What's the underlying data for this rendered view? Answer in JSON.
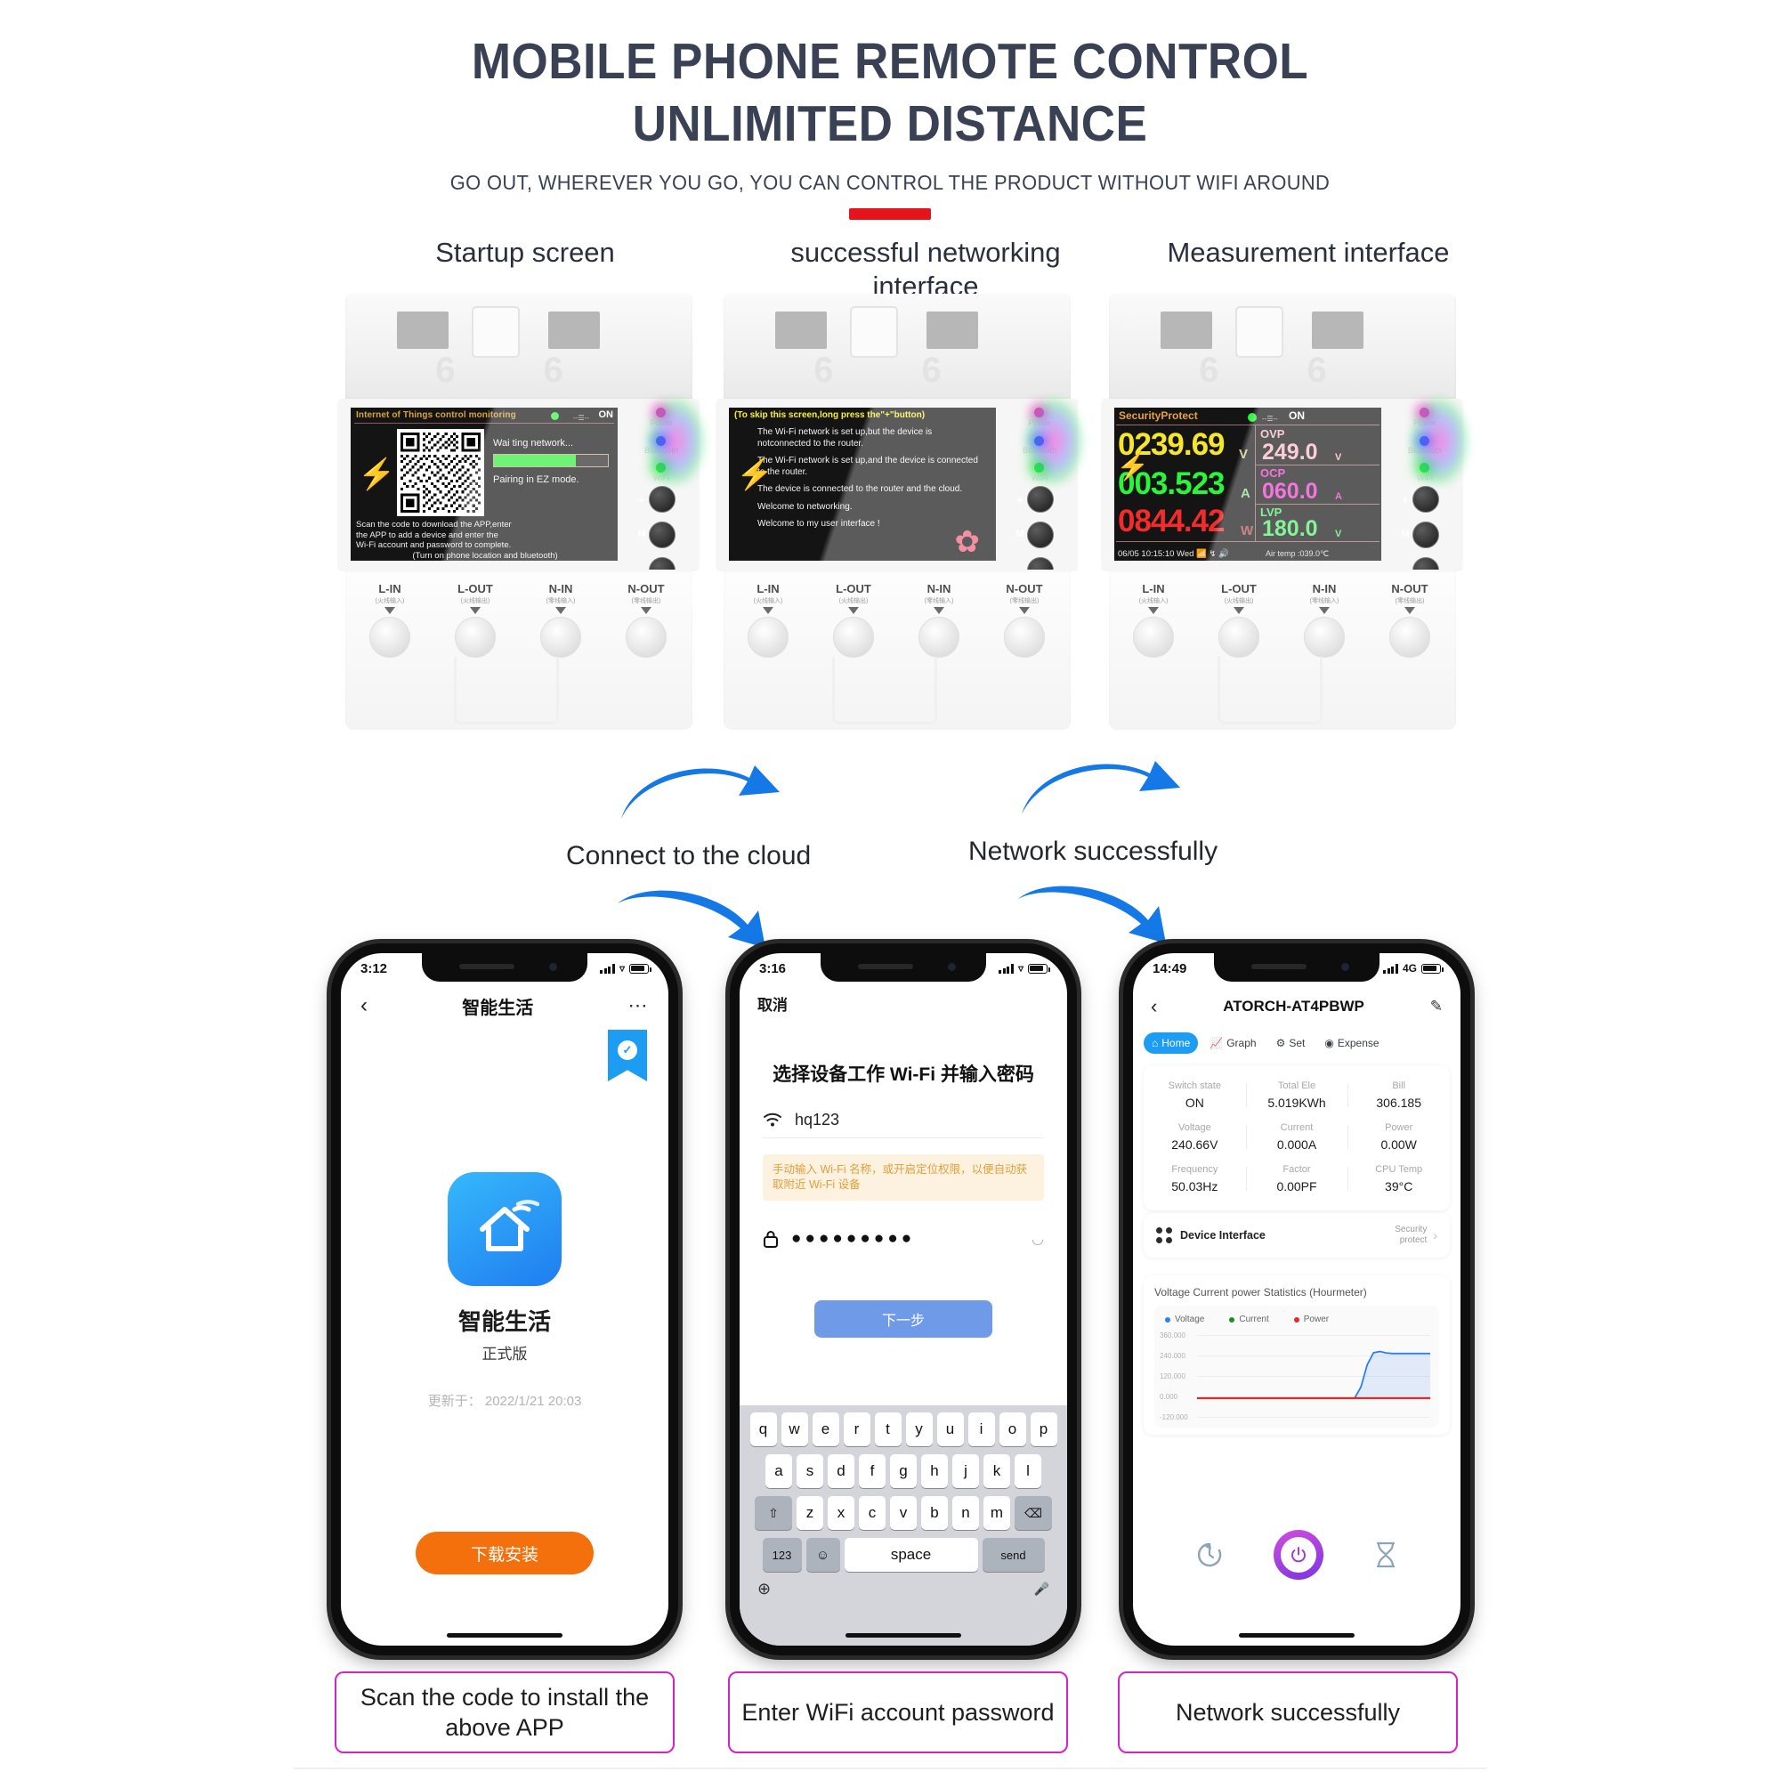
{
  "header": {
    "title_line1": "MOBILE PHONE REMOTE CONTROL",
    "title_line2": "UNLIMITED DISTANCE",
    "subtitle": "GO OUT, WHEREVER YOU GO, YOU CAN CONTROL THE PRODUCT WITHOUT WIFI AROUND"
  },
  "column_titles": [
    "Startup screen",
    "successful networking interface",
    "Measurement interface"
  ],
  "device": {
    "ghost_digits": "6 6",
    "terminals": [
      {
        "name": "L-IN",
        "cn": "(火线输入)"
      },
      {
        "name": "L-OUT",
        "cn": "(火线输出)"
      },
      {
        "name": "N-IN",
        "cn": "(零线输入)"
      },
      {
        "name": "N-OUT",
        "cn": "(零线输出)"
      }
    ],
    "led_labels": [
      "Power",
      "Bluetooth",
      "WiFi"
    ],
    "button_symbols": [
      "+",
      "M",
      "-"
    ]
  },
  "screen1": {
    "title": "Internet of Things control monitoring",
    "status_on": "ON",
    "dash": "--☰--",
    "waiting": "Wai ting network...",
    "pairing": "Pairing in EZ mode.",
    "progress_percent": 72,
    "instructions_l1": "Scan the code to download the APP,enter",
    "instructions_l2": "the APP to add a device and enter the",
    "instructions_l3": "Wi-Fi account and password to complete.",
    "instructions_l4": "(Turn on phone location and bluetooth)"
  },
  "screen2": {
    "skip_note": "(To skip this screen,long press the\"+\"button)",
    "lines": [
      "The Wi-Fi network is set up,but the device is notconnected to the router.",
      "The Wi-Fi network is set up,and the device is connected to the router.",
      "The device is connected to the router and the cloud.",
      "Welcome to networking.",
      "Welcome to my user interface !"
    ]
  },
  "screen3": {
    "title": "SecurityProtect",
    "status_on": "ON",
    "dash": "--☰--",
    "voltage": "0239.69",
    "voltage_unit": "V",
    "current": "003.523",
    "current_unit": "A",
    "power": "0844.42",
    "power_unit": "W",
    "ovp_label": "OVP",
    "ovp_value": "249.0",
    "ovp_unit": "V",
    "ocp_label": "OCP",
    "ocp_value": "060.0",
    "ocp_unit": "A",
    "lvp_label": "LVP",
    "lvp_value": "180.0",
    "lvp_unit": "V",
    "footer_left": "06/05  10:15:10 Wed",
    "footer_right": "Air temp :039.0℃",
    "colors": {
      "voltage": "#f5e62c",
      "current": "#2bf53a",
      "power": "#f22b2b",
      "ovp": "#f8b8c6",
      "ocp": "#f03ad0",
      "lvp": "#4ff06a",
      "title": "#e8a13c"
    }
  },
  "connectors": {
    "label_left": "Connect to the cloud",
    "label_right": "Network successfully"
  },
  "phone1": {
    "time": "3:12",
    "nav_title": "智能生活",
    "back_icon": "chevron-left",
    "more_icon": "ellipsis",
    "app_name": "智能生活",
    "app_version": "正式版",
    "app_updated": "更新于： 2022/1/21 20:03",
    "download_button": "下载安装"
  },
  "phone2": {
    "time": "3:16",
    "cancel": "取消",
    "title": "选择设备工作 Wi-Fi 并输入密码",
    "wifi_name": "hq123",
    "tip": "手动输入 Wi-Fi 名称，或开启定位权限，以便自动获取附近 Wi-Fi 设备",
    "password_masked": "●●●●●●●●●",
    "next_button": "下一步",
    "keyboard": {
      "row1": [
        "q",
        "w",
        "e",
        "r",
        "t",
        "y",
        "u",
        "i",
        "o",
        "p"
      ],
      "row2": [
        "a",
        "s",
        "d",
        "f",
        "g",
        "h",
        "j",
        "k",
        "l"
      ],
      "row3": [
        "⇧",
        "z",
        "x",
        "c",
        "v",
        "b",
        "n",
        "m",
        "⌫"
      ],
      "row4": [
        "123",
        "☺",
        "space",
        "send"
      ],
      "globe": "⊕",
      "mic": "⬤"
    }
  },
  "phone3": {
    "time": "14:49",
    "network": "4G",
    "device_title": "ATORCH-AT4PBWP",
    "tabs": [
      {
        "label": "Home",
        "icon": "home-icon",
        "active": true
      },
      {
        "label": "Graph",
        "icon": "chart-icon",
        "active": false
      },
      {
        "label": "Set",
        "icon": "gear-icon",
        "active": false
      },
      {
        "label": "Expense",
        "icon": "expense-icon",
        "active": false
      }
    ],
    "stats": [
      [
        {
          "key": "Switch state",
          "value": "ON"
        },
        {
          "key": "Total Ele",
          "value": "5.019KWh"
        },
        {
          "key": "Bill",
          "value": "306.185"
        }
      ],
      [
        {
          "key": "Voltage",
          "value": "240.66V"
        },
        {
          "key": "Current",
          "value": "0.000A"
        },
        {
          "key": "Power",
          "value": "0.00W"
        }
      ],
      [
        {
          "key": "Frequency",
          "value": "50.03Hz"
        },
        {
          "key": "Factor",
          "value": "0.00PF"
        },
        {
          "key": "CPU Temp",
          "value": "39°C"
        }
      ]
    ],
    "device_interface_label": "Device Interface",
    "device_interface_value_l1": "Security",
    "device_interface_value_l2": "protect",
    "bottom_controls": [
      "timer-icon",
      "power-button",
      "hourglass-icon"
    ]
  },
  "chart_data": {
    "type": "line",
    "title": "Voltage Current power Statistics (Hourmeter)",
    "series": [
      {
        "name": "Voltage",
        "color": "#2f7ff0",
        "values": [
          0,
          0,
          0,
          0,
          0,
          0,
          0,
          0,
          0,
          0,
          0,
          0,
          0,
          0,
          0,
          0,
          0,
          0,
          0,
          0,
          0,
          0,
          0,
          0,
          0,
          0,
          60,
          180,
          245,
          252,
          244,
          241,
          241,
          241,
          241,
          241,
          241,
          241
        ]
      },
      {
        "name": "Current",
        "color": "#1f8a2f",
        "values": [
          0,
          0,
          0,
          0,
          0,
          0,
          0,
          0,
          0,
          0,
          0,
          0,
          0,
          0,
          0,
          0,
          0,
          0,
          0,
          0,
          0,
          0,
          0,
          0,
          0,
          0,
          0,
          0,
          0,
          0,
          0,
          0,
          0,
          0,
          0,
          0,
          0,
          0
        ]
      },
      {
        "name": "Power",
        "color": "#e02b2b",
        "values": [
          0,
          0,
          0,
          0,
          0,
          0,
          0,
          0,
          0,
          0,
          0,
          0,
          0,
          0,
          0,
          0,
          0,
          0,
          0,
          0,
          0,
          0,
          0,
          0,
          0,
          0,
          0,
          0,
          0,
          0,
          0,
          0,
          0,
          0,
          0,
          0,
          0,
          0
        ]
      }
    ],
    "ylabels": [
      "360.000",
      "240.000",
      "120.000",
      "0.000",
      "-120.000"
    ],
    "ylim": [
      -120,
      360
    ],
    "legend_position": "top-left",
    "grid": true
  },
  "captions": [
    "Scan the code to install the above APP",
    "Enter WiFi account password",
    "Network successfully"
  ]
}
